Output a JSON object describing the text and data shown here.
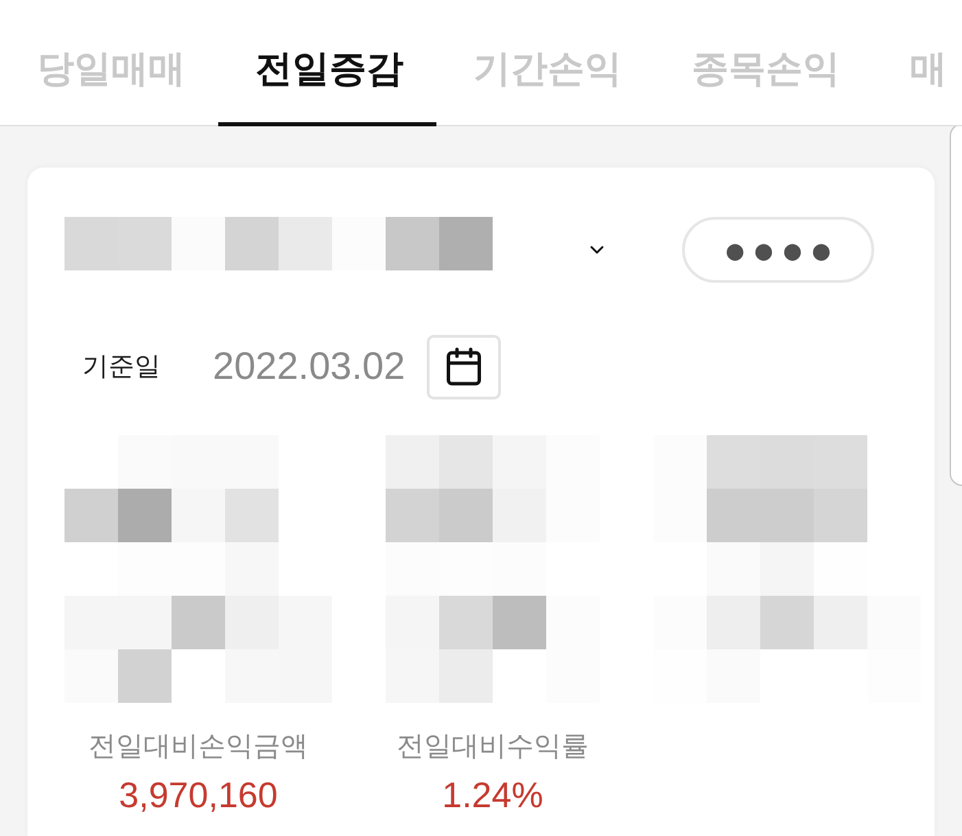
{
  "tabs": [
    {
      "label": "당일매매",
      "selected": false
    },
    {
      "label": "전일증감",
      "selected": true
    },
    {
      "label": "기간손익",
      "selected": false
    },
    {
      "label": "종목손익",
      "selected": false
    },
    {
      "label": "매",
      "selected": false
    }
  ],
  "password_field": {
    "value": "●●●●"
  },
  "base_date": {
    "label": "기준일",
    "value": "2022.03.02"
  },
  "stats": [
    {
      "label": "전일대비손익금액",
      "value": "3,970,160",
      "gain": true
    },
    {
      "label": "전일대비수익률",
      "value": "1.24%",
      "gain": true
    }
  ]
}
